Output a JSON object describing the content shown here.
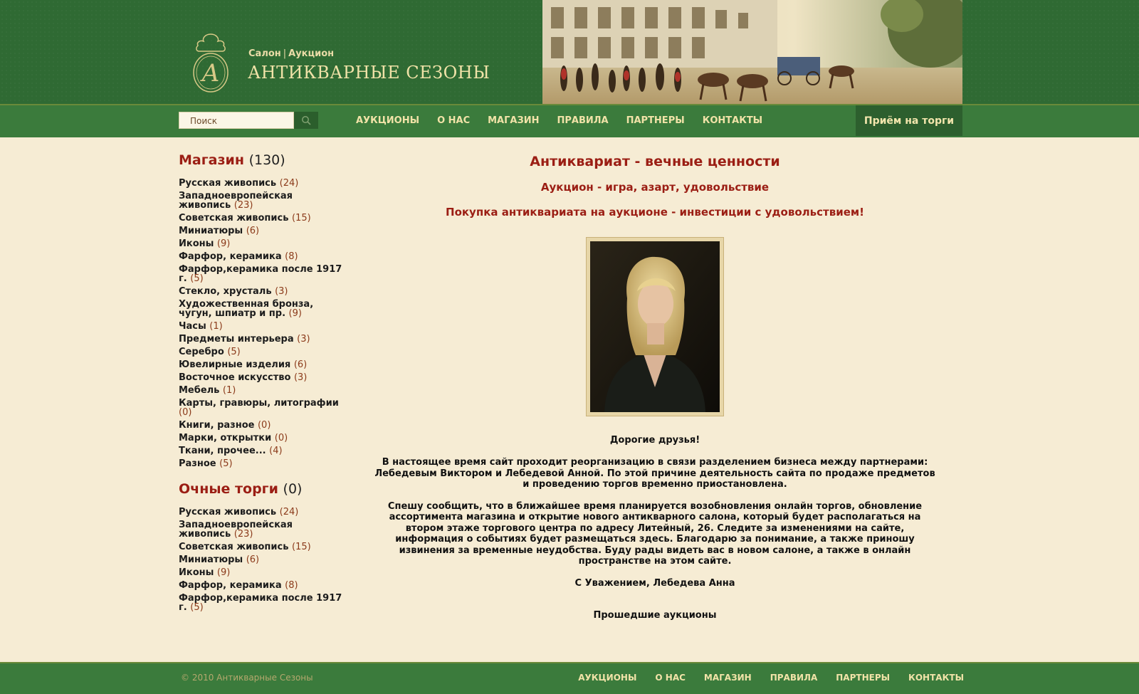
{
  "header": {
    "subtitle_a": "Салон",
    "subtitle_sep": "|",
    "subtitle_b": "Аукцион",
    "title": "АНТИКВАРНЫЕ СЕЗОНЫ",
    "logo_icon": "monogram-a-emblem"
  },
  "nav": {
    "search_placeholder": "Поиск",
    "search_icon": "search-icon",
    "items": [
      "АУКЦИОНЫ",
      "О НАС",
      "МАГАЗИН",
      "ПРАВИЛА",
      "ПАРТНЕРЫ",
      "КОНТАКТЫ"
    ],
    "cta": "Приём на торги"
  },
  "sidebar": {
    "shop_title": "Магазин",
    "shop_count": "(130)",
    "shop_items": [
      {
        "label": "Русская живопись",
        "count": "(24)"
      },
      {
        "label": "Западноевропейская живопись",
        "count": "(23)"
      },
      {
        "label": "Советская живопись",
        "count": "(15)"
      },
      {
        "label": "Миниатюры",
        "count": "(6)"
      },
      {
        "label": "Иконы",
        "count": "(9)"
      },
      {
        "label": "Фарфор, керамика",
        "count": "(8)"
      },
      {
        "label": "Фарфор,керамика после 1917 г.",
        "count": "(5)"
      },
      {
        "label": "Стекло, хрусталь",
        "count": "(3)"
      },
      {
        "label": "Художественная бронза, чугун, шпиатр и пр.",
        "count": "(9)"
      },
      {
        "label": "Часы",
        "count": "(1)"
      },
      {
        "label": "Предметы интерьера",
        "count": "(3)"
      },
      {
        "label": "Серебро",
        "count": "(5)"
      },
      {
        "label": "Ювелирные изделия",
        "count": "(6)"
      },
      {
        "label": "Восточное искусство",
        "count": "(3)"
      },
      {
        "label": "Мебель",
        "count": "(1)"
      },
      {
        "label": "Карты, гравюры, литографии",
        "count": "(0)"
      },
      {
        "label": "Книги, разное",
        "count": "(0)"
      },
      {
        "label": "Марки, открытки",
        "count": "(0)"
      },
      {
        "label": "Ткани, прочее...",
        "count": "(4)"
      },
      {
        "label": "Разное",
        "count": "(5)"
      }
    ],
    "auction_title": "Очные торги",
    "auction_count": "(0)",
    "auction_items": [
      {
        "label": "Русская живопись",
        "count": "(24)"
      },
      {
        "label": "Западноевропейская живопись",
        "count": "(23)"
      },
      {
        "label": "Советская живопись",
        "count": "(15)"
      },
      {
        "label": "Миниатюры",
        "count": "(6)"
      },
      {
        "label": "Иконы",
        "count": "(9)"
      },
      {
        "label": "Фарфор, керамика",
        "count": "(8)"
      },
      {
        "label": "Фарфор,керамика после 1917 г.",
        "count": "(5)"
      }
    ]
  },
  "main": {
    "heading": "Антиквариат - вечные ценности",
    "subheading": "Аукцион - игра, азарт, удовольствие",
    "tagline": "Покупка антиквариата на аукционе - инвестиции с удовольствием!",
    "greeting": "Дорогие друзья!",
    "paragraph1": "В настоящее время сайт проходит реорганизацию в связи разделением бизнеса между партнерами: Лебедевым Виктором и Лебедевой Анной. По этой причине деятельность сайта по продаже предметов и проведению торгов временно приостановлена.",
    "paragraph2": "Спешу сообщить, что в ближайшее время планируется возобновления онлайн торгов, обновление ассортимента магазина и открытие нового антикварного салона, который будет располагаться на втором этаже торгового центра по адресу Литейный, 26. Следите за изменениями на сайте, информация о событиях будет размещаться здесь. Благодарю за понимание, а также приношу извинения за временные неудобства. Буду рады видеть вас в новом салоне, а также в онлайн пространстве на этом сайте.",
    "signature": "С Уважением, Лебедева Анна",
    "past_link": "Прошедшие аукционы"
  },
  "footer": {
    "copyright": "© 2010 Антикварные  Сезоны",
    "items": [
      "АУКЦИОНЫ",
      "О НАС",
      "МАГАЗИН",
      "ПРАВИЛА",
      "ПАРТНЕРЫ",
      "КОНТАКТЫ"
    ]
  },
  "colors": {
    "brand_green": "#2f6a33",
    "nav_green": "#3b7b3c",
    "accent_red": "#9b1e14",
    "page_bg": "#f6ecd4",
    "gold_text": "#f1e3a8"
  }
}
